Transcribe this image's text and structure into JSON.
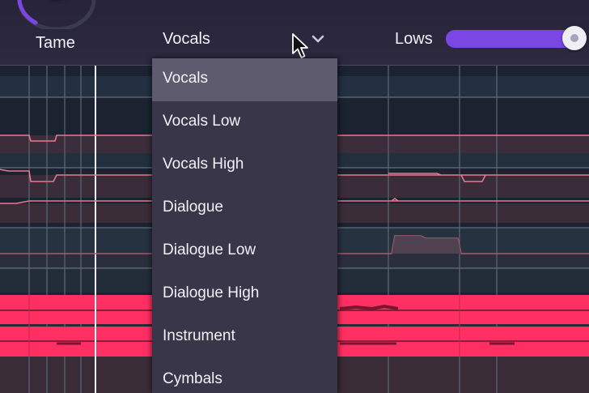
{
  "tame_knob": {
    "label": "Tame",
    "accent_color": "#7b47e4"
  },
  "mode_select": {
    "value": "Vocals",
    "options": [
      "Vocals",
      "Vocals Low",
      "Vocals High",
      "Dialogue",
      "Dialogue Low",
      "Dialogue High",
      "Instrument",
      "Cymbals"
    ],
    "selected_index": 0
  },
  "lows_slider": {
    "label": "Lows",
    "value_fraction": 0.9,
    "fill_color": "#7b47e4"
  },
  "colors": {
    "background": "#1b2330",
    "curve": "#e7788f",
    "curve_band": "#5a3342",
    "signal": "#ff2f63",
    "dropdown_bg": "#3a3649",
    "dropdown_selected": "#5e5b6f"
  },
  "icons": {
    "dropdown_arrow": "chevron-down-icon",
    "pointer": "mouse-cursor-icon"
  }
}
